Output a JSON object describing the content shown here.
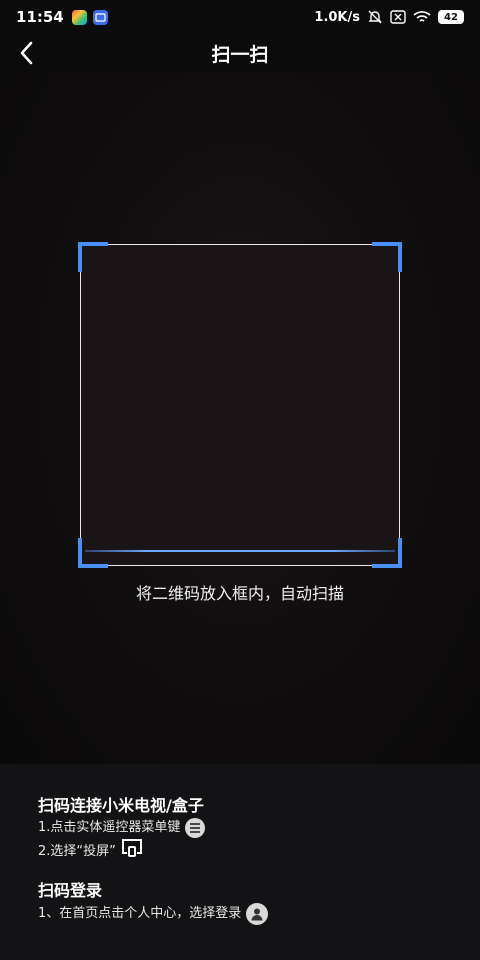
{
  "status_bar": {
    "time": "11:54",
    "network_speed": "1.0K/s",
    "battery": "42",
    "icons": [
      "app-badge-icon",
      "gallery-icon",
      "mute-bell-icon",
      "sim-icon",
      "wifi-icon",
      "battery-icon"
    ]
  },
  "nav": {
    "back_icon": "chevron-left-icon",
    "title": "扫一扫"
  },
  "scanner": {
    "frame_color": "#4a8ff5",
    "hint": "将二维码放入框内，自动扫描"
  },
  "help": {
    "connect_title": "扫码连接小米电视/盒子",
    "connect_step1": "1.点击实体遥控器菜单键",
    "connect_step1_icon": "menu-icon",
    "connect_step2": "2.选择“投屏”",
    "connect_step2_icon": "cast-screen-icon",
    "login_title": "扫码登录",
    "login_step1": "1、在首页点击个人中心，选择登录",
    "login_step1_icon": "user-avatar-icon"
  }
}
